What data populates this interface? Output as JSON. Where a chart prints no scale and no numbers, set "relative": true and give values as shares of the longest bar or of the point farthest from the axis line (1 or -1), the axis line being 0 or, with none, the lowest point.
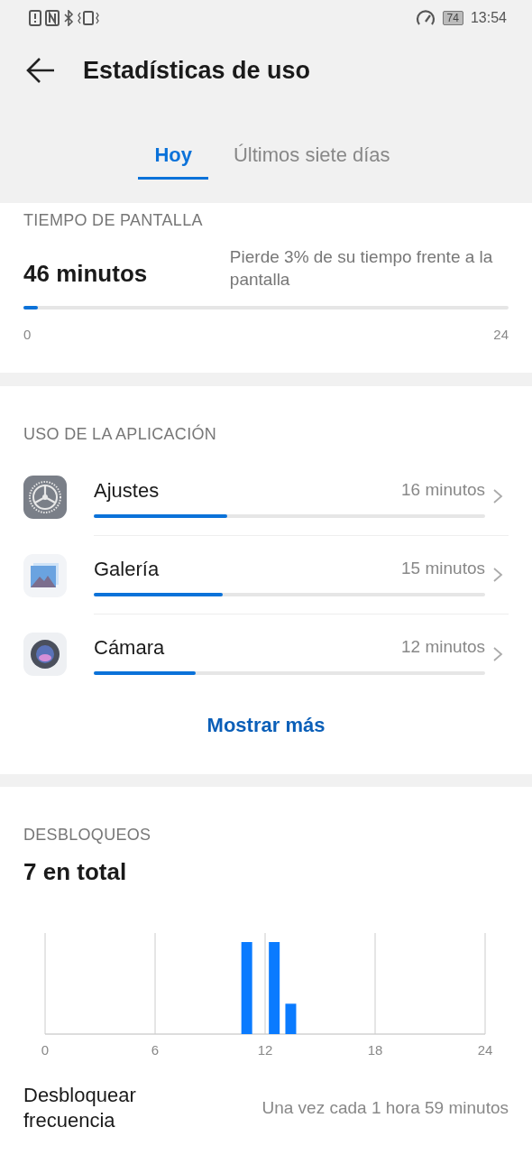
{
  "status_bar": {
    "battery": "74",
    "time": "13:54"
  },
  "header": {
    "title": "Estadísticas de uso"
  },
  "tabs": [
    {
      "label": "Hoy",
      "selected": true
    },
    {
      "label": "Últimos siete días",
      "selected": false
    }
  ],
  "screen_time": {
    "heading": "TIEMPO DE PANTALLA",
    "total": "46 minutos",
    "note": "Pierde 3% de su tiempo frente a la pantalla",
    "level": 0.03,
    "scale_start": "0",
    "scale_end": "24"
  },
  "app_usage": {
    "heading": "USO DE LA APLICACIÓN",
    "apps": [
      {
        "name": "Ajustes",
        "time": "16 minutos",
        "level": 0.34
      },
      {
        "name": "Galería",
        "time": "15 minutos",
        "level": 0.33
      },
      {
        "name": "Cámara",
        "time": "12 minutos",
        "level": 0.26
      }
    ],
    "show_more": "Mostrar más"
  },
  "unlocks": {
    "heading": "DESBLOQUEOS",
    "total": "7 en total",
    "chart_data": {
      "type": "bar",
      "x": [
        11,
        12.5,
        13.4
      ],
      "values": [
        1,
        1,
        0.33
      ],
      "xlim": [
        0,
        24
      ],
      "relative": true,
      "grid": true,
      "xticks": [
        0,
        6,
        12,
        18,
        24
      ]
    },
    "frequency_label": "Desbloquear frecuencia",
    "frequency_value": "Una vez cada 1 hora 59 minutos"
  }
}
